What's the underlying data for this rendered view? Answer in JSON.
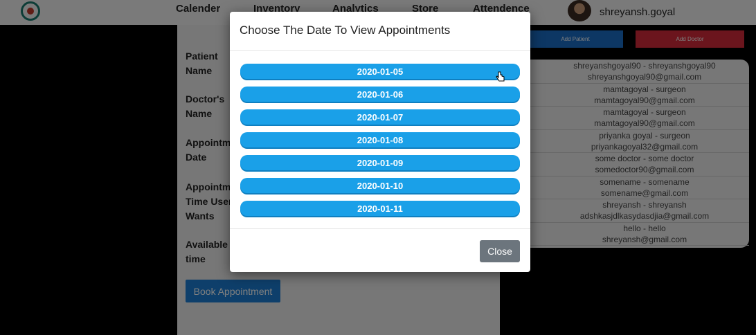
{
  "navbar": {
    "items": [
      "Calender",
      "Inventory",
      "Analytics",
      "Store",
      "Attendence"
    ],
    "user_name": "shreyansh.goyal"
  },
  "form": {
    "labels": [
      "Patient Name",
      "Doctor's Name",
      "Appointment Date",
      "Appointment Time User Wants",
      "Available time"
    ],
    "book_button": "Book Appointment"
  },
  "right_panel": {
    "add_patient": "Add Patient",
    "add_doctor": "Add Doctor",
    "doctors": [
      {
        "line1": "shreyanshgoyal90  -  shreyanshgoyal90",
        "line2": "shreyanshgoyal90@gmail.com"
      },
      {
        "line1": "mamtagoyal  -  surgeon",
        "line2": "mamtagoyal90@gmail.com"
      },
      {
        "line1": "mamtagoyal  -  surgeon",
        "line2": "mamtagoyal90@gmail.com"
      },
      {
        "line1": "priyanka goyal  -  surgeon",
        "line2": "priyankagoyal32@gmail.com"
      },
      {
        "line1": "some doctor  -  some doctor",
        "line2": "somedoctor90@gmail.com"
      },
      {
        "line1": "somename  -  somename",
        "line2": "somename@gmail.com"
      },
      {
        "line1": "shreyansh  -  shreyansh",
        "line2": "adshkasjdlkasydasdjia@gmail.com"
      },
      {
        "line1": "hello  -  hello",
        "line2": "shreyansh@gmail.com"
      }
    ]
  },
  "modal": {
    "title": "Choose The Date To View Appointments",
    "dates": [
      "2020-01-05",
      "2020-01-06",
      "2020-01-07",
      "2020-01-08",
      "2020-01-09",
      "2020-01-10",
      "2020-01-11"
    ],
    "close_label": "Close"
  },
  "colors": {
    "date_button": "#1aa0e8",
    "close_button": "#6c757d",
    "add_patient": "#1b6fc8",
    "add_doctor": "#d62b3a",
    "book_button": "#1d7fd6"
  }
}
